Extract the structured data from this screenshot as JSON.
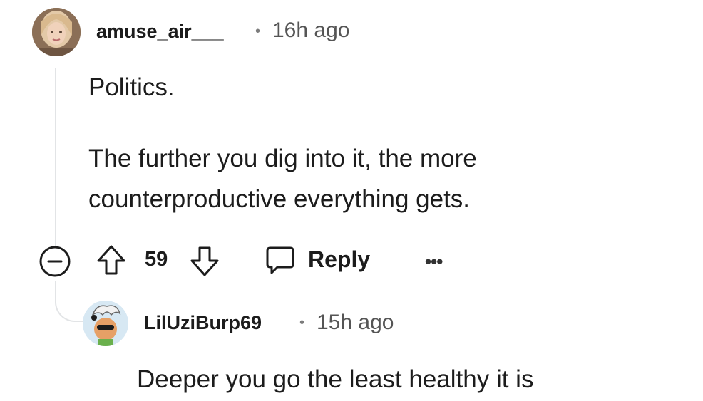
{
  "comment": {
    "username": "amuse_air___",
    "separator": "•",
    "timestamp": "16h ago",
    "paragraph_1": "Politics.",
    "paragraph_2_line_1": "The further you dig into it, the more",
    "paragraph_2_line_2": "counterproductive everything gets.",
    "vote_count": "59",
    "reply_label": "Reply",
    "more_label": "•••"
  },
  "reply": {
    "username": "LilUziBurp69",
    "separator": "•",
    "timestamp": "15h ago",
    "body": "Deeper you go the least healthy it is"
  },
  "icons": {
    "collapse": "minus-circle-icon",
    "upvote": "arrow-up-icon",
    "downvote": "arrow-down-icon",
    "reply": "speech-bubble-icon",
    "more": "ellipsis-icon"
  }
}
